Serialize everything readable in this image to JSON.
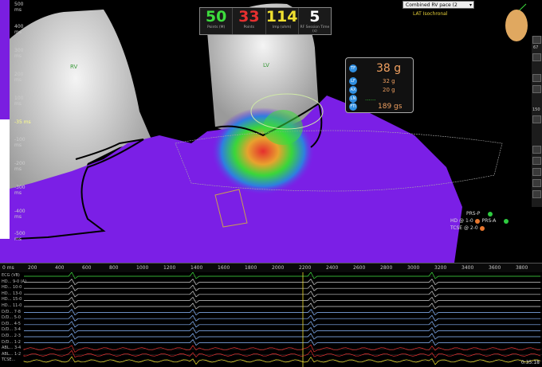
{
  "colorbar": {
    "ticks": [
      "500 ms",
      "400 ms",
      "300 ms",
      "200 ms",
      "100 ms",
      "-35 ms",
      "-100 ms",
      "-200 ms",
      "-300 ms",
      "-400 ms",
      "-500 ms"
    ],
    "marker": "-35 ms"
  },
  "anatomy": {
    "rv_label": "RV",
    "lv_label": "LV"
  },
  "stats": [
    {
      "value": "50",
      "label": "Points (M)",
      "color": "#3ddc3d"
    },
    {
      "value": "33",
      "label": "Points",
      "color": "#e53030"
    },
    {
      "value": "114",
      "label": "Imp (ohm)",
      "color": "#f0e030"
    },
    {
      "value": "5",
      "label": "RF Session Time (s)",
      "color": "#ffffff"
    }
  ],
  "map": {
    "selector_value": "Combined RV pace (2",
    "map_name": "LAT Isochronal"
  },
  "force": {
    "main": "38 g",
    "rows": [
      "32 g",
      "20 g",
      "......",
      "189 gs"
    ],
    "icon_labels": [
      "TF",
      "LF",
      "AX",
      "LN",
      "FTI"
    ]
  },
  "toolbar": {
    "zoom_top": "67",
    "zoom_mid": "150"
  },
  "legend": [
    {
      "label": "PRS-P",
      "color": "#2ecc40"
    },
    {
      "label": "HD @ 1-0",
      "color": "#e8772e"
    },
    {
      "label": "PRS-A",
      "color": "#2ecc40"
    },
    {
      "label": "TCSE @ 2-0",
      "color": "#e8772e"
    }
  ],
  "timeline": {
    "start": "0 ms",
    "ticks": [
      "200",
      "400",
      "600",
      "800",
      "1000",
      "1200",
      "1400",
      "1600",
      "1800",
      "2000",
      "2200",
      "2400",
      "2600",
      "2800",
      "3000",
      "3200",
      "3400",
      "3600",
      "3800",
      "4"
    ]
  },
  "ecg": {
    "channels": [
      "ECG (VB)",
      "HD... 9-0 (A)",
      "HD... 10-0",
      "HD... 13-0",
      "HD... 15-0",
      "HD... 11-0",
      "D/D... 7-8",
      "D/D... 5-0",
      "D/D... 4-5",
      "D/D... 3-4",
      "D/D... 2-3",
      "D/D... 1-2",
      "ABL... 3-4",
      "ABL... 1-2",
      "TCSE..."
    ],
    "timer": "0:35:18"
  },
  "colors": {
    "purple": "#7b1fe6",
    "accent": "#2f8ee0"
  }
}
